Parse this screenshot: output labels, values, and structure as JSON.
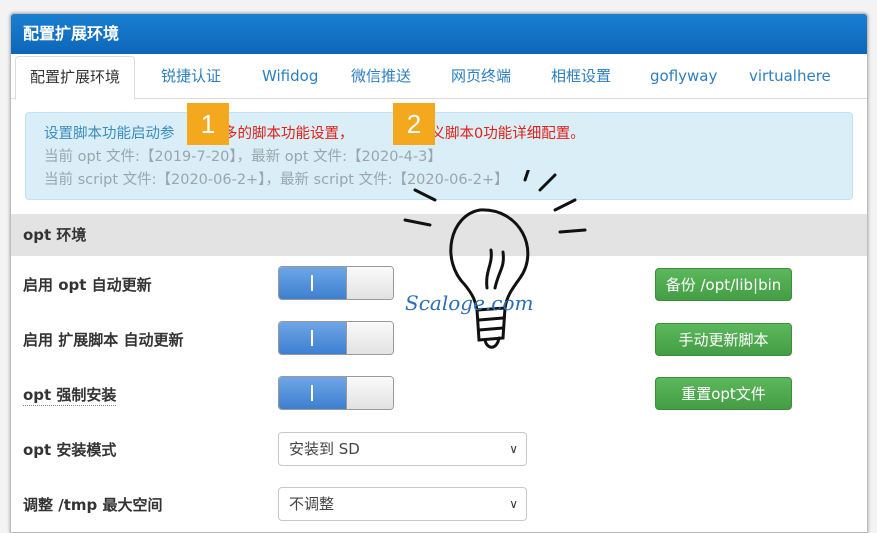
{
  "window": {
    "title": "配置扩展环境"
  },
  "tabs": [
    "配置扩展环境",
    "锐捷认证",
    "Wifidog",
    "微信推送",
    "网页终端",
    "相框设置",
    "goflyway",
    "virtualhere"
  ],
  "alert": {
    "line1_prefix": "设置脚本功能启动参",
    "line1_red": "更多的脚本功能设置，",
    "line1_red2": "自定义脚本0功能详细配置。",
    "line2": "当前 opt 文件:【2019-7-20】，最新 opt 文件:【2020-4-3】",
    "line3": "当前 script 文件:【2020-06-2+】，最新 script 文件:【2020-06-2+】"
  },
  "section": {
    "title": "opt 环境"
  },
  "rows": [
    {
      "label": "启用 opt 自动更新",
      "toggle": "on",
      "button": "备份 /opt/lib|bin"
    },
    {
      "label": "启用 扩展脚本 自动更新",
      "toggle": "on",
      "button": "手动更新脚本"
    },
    {
      "label": "opt 强制安装",
      "toggle": "on",
      "button": "重置opt文件"
    },
    {
      "label": "opt 安装模式",
      "select": "安装到 SD"
    },
    {
      "label": "调整 /tmp 最大空间",
      "select": "不调整"
    }
  ],
  "badges": [
    "1",
    "2"
  ],
  "toggle_glyph": "I",
  "select_chevron": "∨",
  "watermark": "Scaloge.com",
  "colors": {
    "title_bar": "#0d66b8",
    "link": "#2d7fc0",
    "warning": "#e0201a",
    "button": "#5cb85c",
    "toggle": "#3d7fd0",
    "badge": "#f4a81d"
  }
}
